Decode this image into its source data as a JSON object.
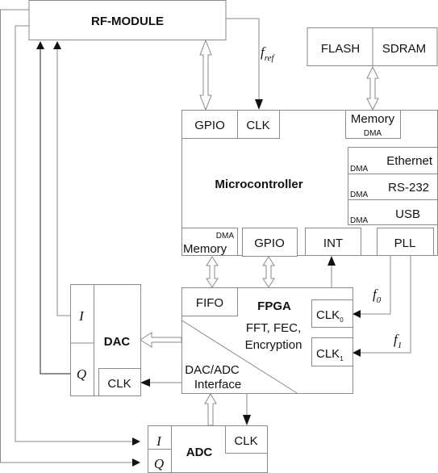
{
  "blocks": {
    "rf_module": "RF-MODULE",
    "flash": "FLASH",
    "sdram": "SDRAM",
    "microcontroller": "Microcontroller",
    "mc_gpio_top": "GPIO",
    "mc_clk": "CLK",
    "mc_memory_top": "Memory",
    "dma": "DMA",
    "ethernet": "Ethernet",
    "rs232": "RS-232",
    "usb": "USB",
    "mc_memory_bottom": "Memory",
    "mc_gpio_bottom": "GPIO",
    "int": "INT",
    "pll": "PLL",
    "fpga": "FPGA",
    "fifo": "FIFO",
    "fpga_func_1": "FFT, FEC,",
    "fpga_func_2": "Encryption",
    "clk": "CLK",
    "sub0": "0",
    "sub1": "1",
    "interface_1": "DAC/ADC",
    "interface_2": "Interface",
    "dac": "DAC",
    "adc": "ADC",
    "i": "I",
    "q": "Q"
  },
  "signals": {
    "f": "f",
    "ref": "ref",
    "zero": "0",
    "one": "1"
  }
}
